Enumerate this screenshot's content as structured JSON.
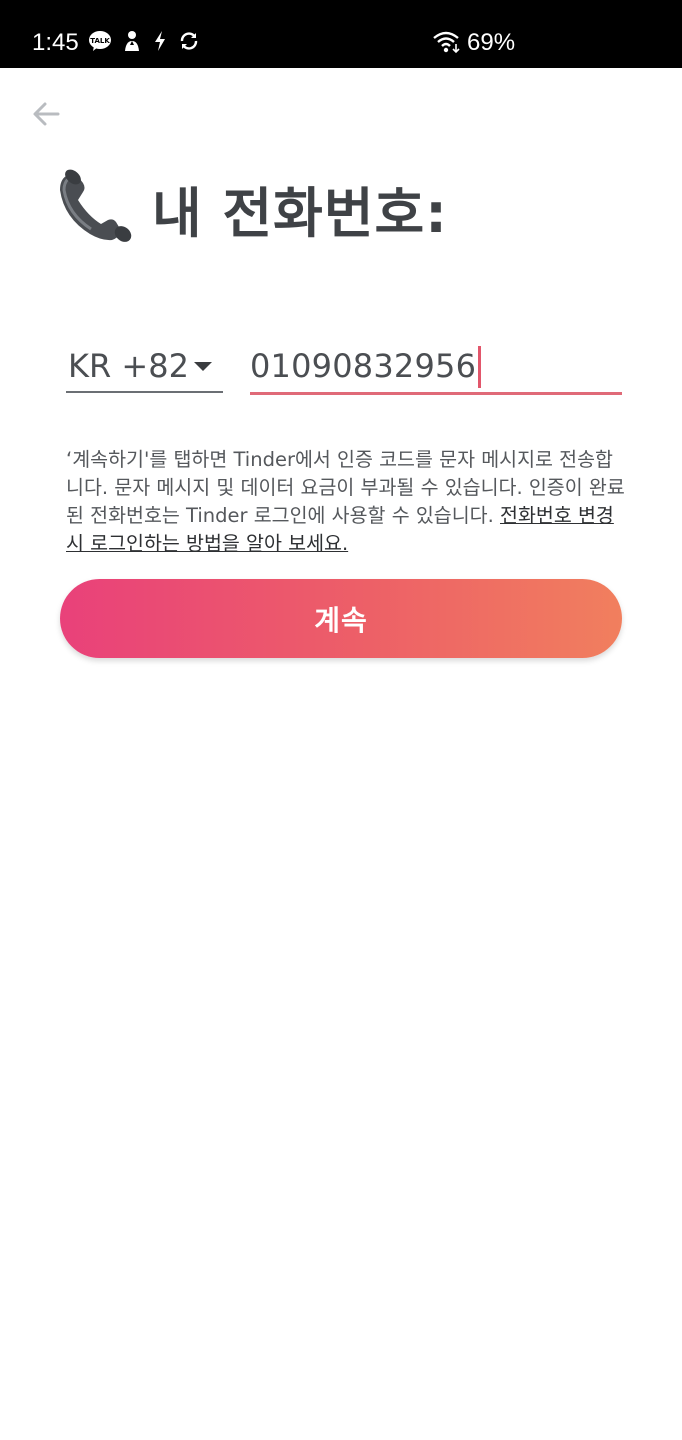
{
  "status_bar": {
    "time": "1:45",
    "battery": "69%",
    "icons": [
      "kakaotalk-icon",
      "person-notification-icon",
      "bolt-icon",
      "sync-icon",
      "wifi-icon"
    ],
    "kakao_badge": "TALK"
  },
  "header": {
    "back_icon": "arrow-left-icon",
    "title_icon": "telephone-receiver-icon",
    "title": "내 전화번호:"
  },
  "form": {
    "country_code": "KR +82",
    "phone_number": "01090832956"
  },
  "disclaimer": {
    "text": "‘계속하기'를 탭하면 Tinder에서 인증 코드를 문자 메시지로 전송합니다. 문자 메시지 및 데이터 요금이 부과될 수 있습니다. 인증이 완료된 전화번호는 Tinder 로그인에 사용할 수 있습니다. ",
    "link": "전화번호 변경 시 로그인하는 방법을 알아 보세요."
  },
  "continue_button": {
    "label": "계속"
  },
  "colors": {
    "accent_start": "#e9417a",
    "accent_end": "#f17f5e",
    "input_focus": "#e06a78"
  }
}
